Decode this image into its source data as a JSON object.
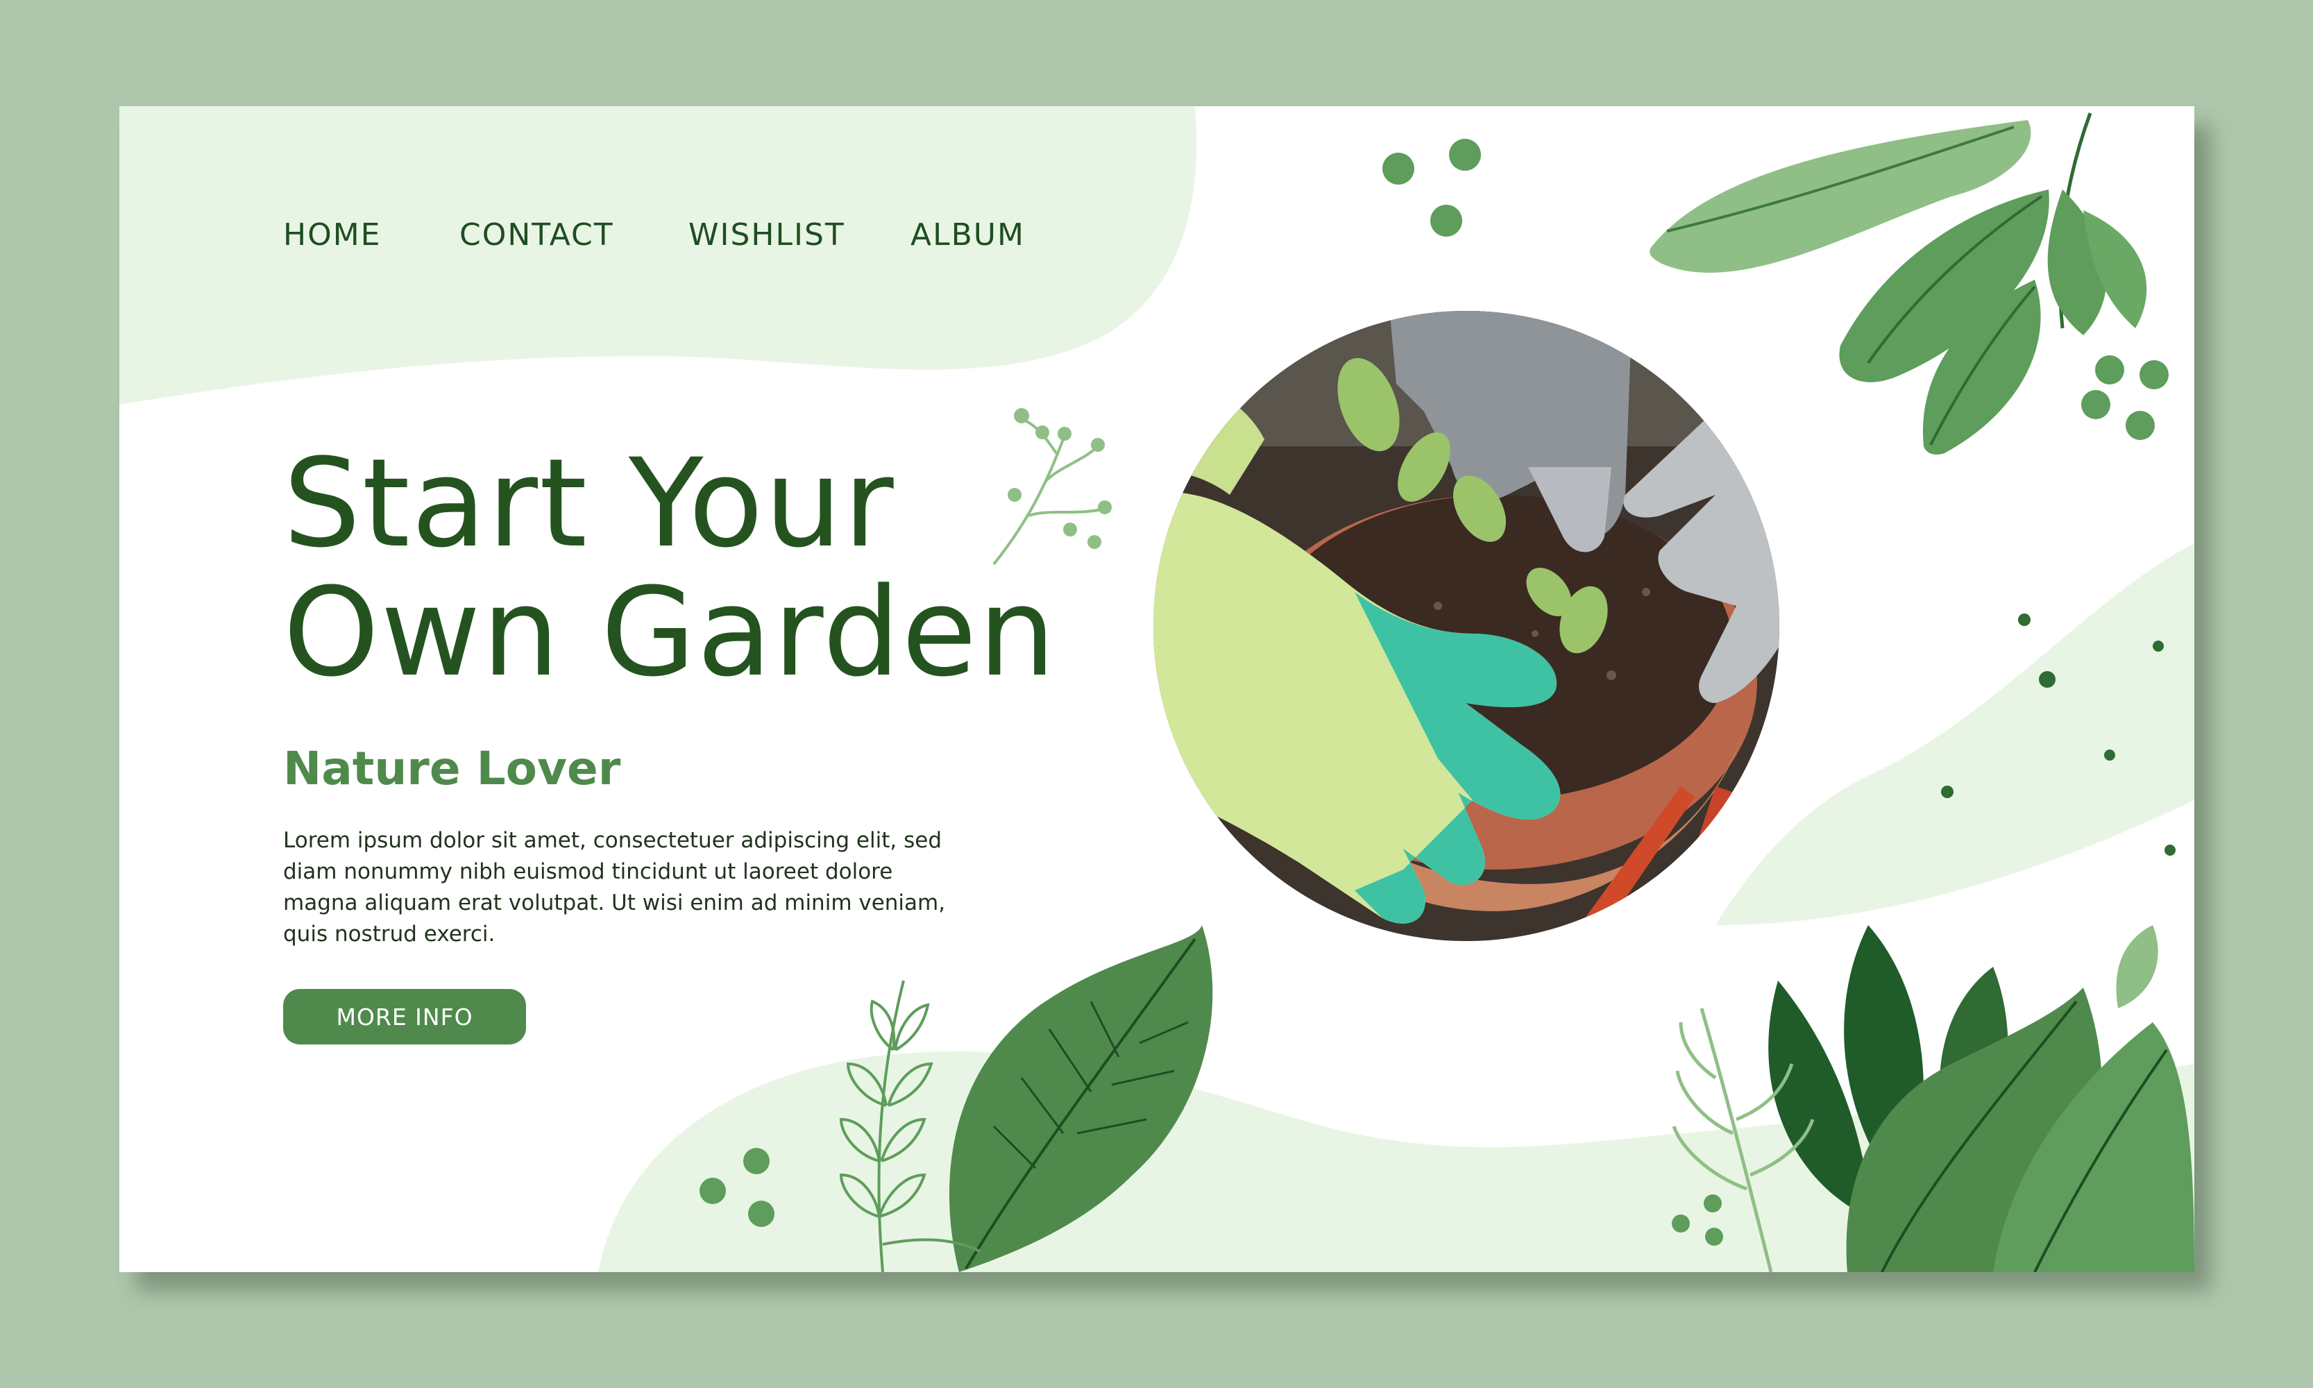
{
  "nav": {
    "items": [
      {
        "label": "HOME"
      },
      {
        "label": "CONTACT"
      },
      {
        "label": "WISHLIST"
      },
      {
        "label": "ALBUM"
      }
    ]
  },
  "hero": {
    "headline_line1": "Start Your",
    "headline_line2": "Own Garden",
    "subtitle": "Nature Lover",
    "body": "Lorem ipsum dolor sit amet, consectetuer adipiscing elit, sed diam nonummy nibh euismod tincidunt ut laoreet dolore magna aliquam erat volutpat. Ut wisi enim ad minim veniam, quis nostrud exerci.",
    "button_label": "MORE INFO"
  },
  "photo": {
    "subject": "gardening-gloves-planting-seedlings-icon"
  },
  "colors": {
    "page_bg": "#aec6ab",
    "card_bg": "#ffffff",
    "pale_green": "#e8f5e4",
    "light_green": "#d9efd3",
    "dark_green": "#1f4d22",
    "accent_green": "#4f8a4c",
    "leaf_green": "#5e9d5b",
    "deep_leaf": "#2f6b33"
  }
}
